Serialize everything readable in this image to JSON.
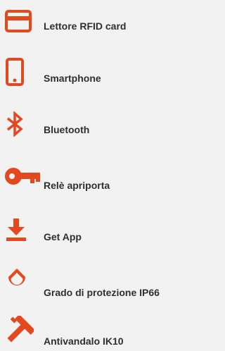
{
  "colors": {
    "accent": "#e2491f",
    "text": "#2f2f2f",
    "background": "#f2f2f2"
  },
  "features": [
    {
      "label": "Lettore RFID card",
      "icon": "rfid-card-icon"
    },
    {
      "label": "Smartphone",
      "icon": "smartphone-icon"
    },
    {
      "label": "Bluetooth",
      "icon": "bluetooth-icon"
    },
    {
      "label": "Relè apriporta",
      "icon": "key-icon"
    },
    {
      "label": "Get App",
      "icon": "download-icon"
    },
    {
      "label": "Grado di protezione IP66",
      "icon": "water-drop-icon"
    },
    {
      "label": "Antivandalo IK10",
      "icon": "hammer-icon"
    }
  ]
}
